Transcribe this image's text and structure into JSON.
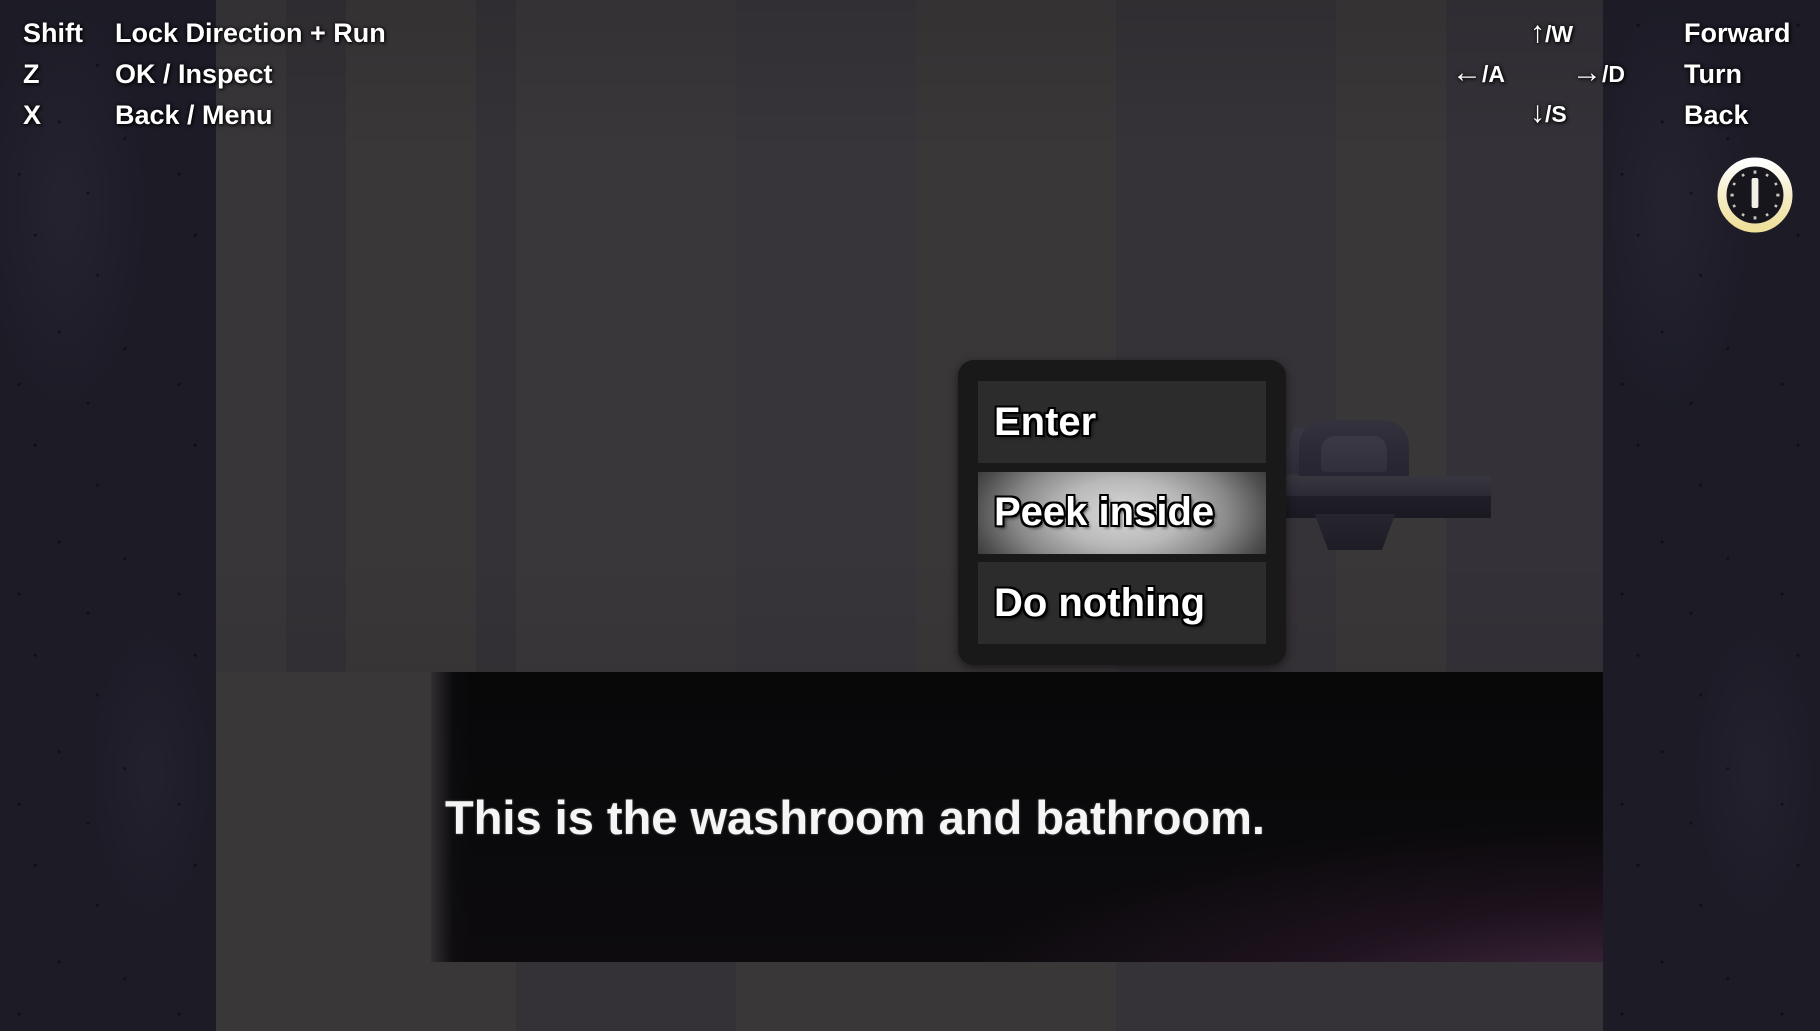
{
  "hud": {
    "key_hints": [
      {
        "key": "Shift",
        "action": "Lock Direction + Run"
      },
      {
        "key": "Z",
        "action": "OK / Inspect"
      },
      {
        "key": "X",
        "action": "Back / Menu"
      }
    ],
    "movement": {
      "up": {
        "glyph": "↑",
        "key": "/W"
      },
      "left": {
        "glyph": "←",
        "key": "/A"
      },
      "right": {
        "glyph": "→",
        "key": "/D"
      },
      "down": {
        "glyph": "↓",
        "key": "/S"
      }
    },
    "movement_actions": [
      "Forward",
      "Turn",
      "Back"
    ],
    "clock_icon": "clock-icon"
  },
  "choice_menu": {
    "options": [
      {
        "label": "Enter",
        "selected": false
      },
      {
        "label": "Peek inside",
        "selected": true
      },
      {
        "label": "Do nothing",
        "selected": false
      }
    ]
  },
  "dialogue": {
    "text": "This is the washroom and bathroom."
  },
  "scene": {
    "objects": [
      {
        "name": "bathroom-sink"
      }
    ]
  },
  "colors": {
    "letterbox": "#1c1b26",
    "wall": "#393639",
    "menu_frame": "#191919",
    "menu_item": "#2c2c2c",
    "menu_selected_center": "#d8d8d8",
    "dialogue_background": "#0a090b",
    "dialogue_glow": "#be6eaf",
    "clock_ring": "#f5e9b8",
    "text": "#ffffff"
  }
}
